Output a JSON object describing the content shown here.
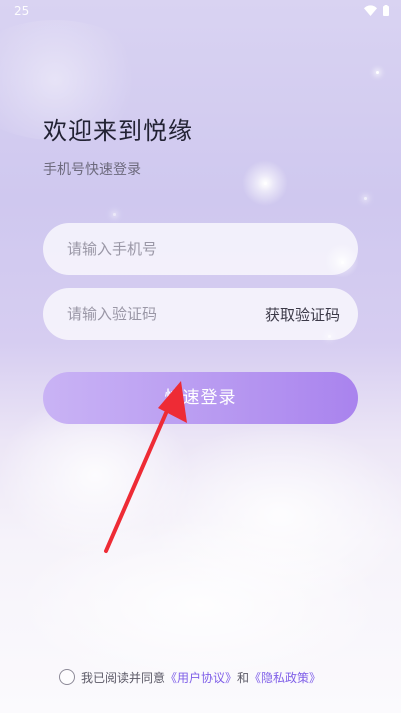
{
  "status_bar": {
    "time": "25",
    "icons": [
      "wifi-icon",
      "battery-icon"
    ]
  },
  "login": {
    "title": "欢迎来到悦缘",
    "subtitle": "手机号快速登录",
    "phone_placeholder": "请输入手机号",
    "code_placeholder": "请输入验证码",
    "get_code_label": "获取验证码",
    "login_button_label": "快速登录"
  },
  "agreement": {
    "prefix": "我已阅读并同意",
    "user_agreement": "《用户协议》",
    "conjunction": "和",
    "privacy_policy": "《隐私政策》"
  },
  "annotation": {
    "icon": "red-arrow-icon",
    "color": "#ee2b35"
  },
  "colors": {
    "accent": "#a983ee",
    "link": "#7f5fe8"
  }
}
